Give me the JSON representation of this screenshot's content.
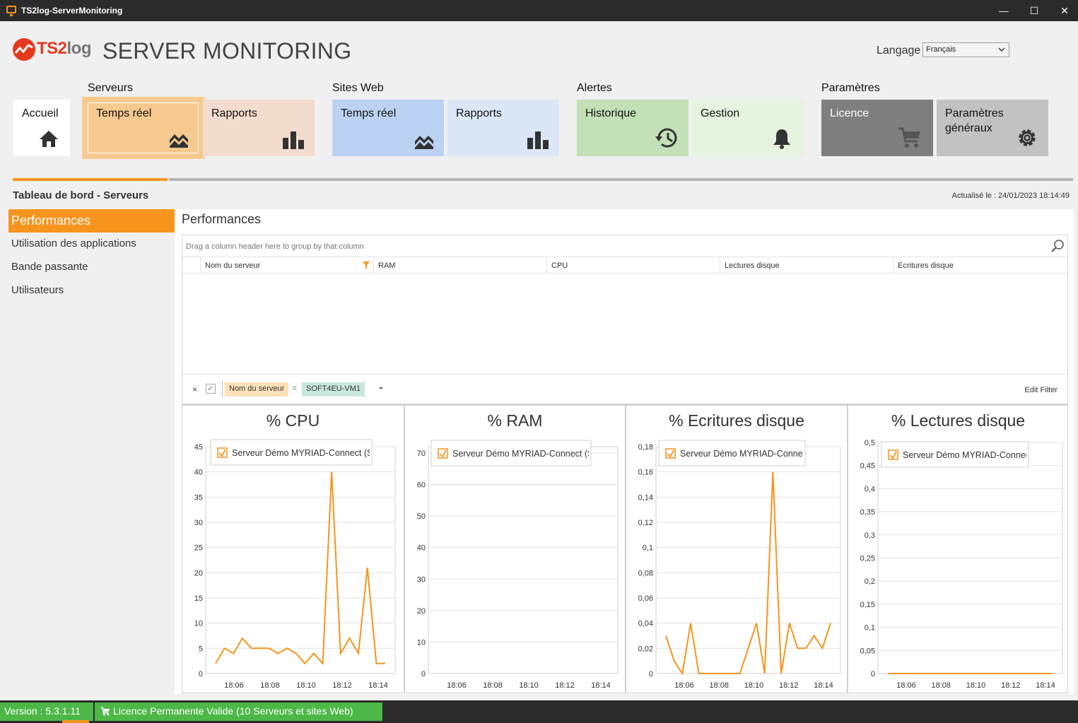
{
  "window": {
    "title": "TS2log-ServerMonitoring"
  },
  "header": {
    "brand_a": "TS2",
    "brand_b": "log",
    "app_title": "SERVER MONITORING",
    "language_label": "Langage",
    "language_value": "Français"
  },
  "groups": {
    "servers": "Serveurs",
    "sites": "Sites Web",
    "alerts": "Alertes",
    "settings": "Paramètres"
  },
  "tiles": {
    "home": "Accueil",
    "srv_realtime": "Temps réel",
    "srv_reports": "Rapports",
    "web_realtime": "Temps réel",
    "web_reports": "Rapports",
    "history": "Historique",
    "management": "Gestion",
    "license": "Licence",
    "general_settings": "Paramètres généraux"
  },
  "colors": {
    "accent": "#f7941d",
    "tile_srv_realtime": "#f5c98f",
    "tile_srv_reports": "#f3dccd",
    "tile_web_realtime": "#bcd2f2",
    "tile_web_reports": "#dbe7f7",
    "tile_history": "#c4e0b7",
    "tile_management": "#e6f3df",
    "tile_license": "#7f7f7f",
    "tile_general": "#c2c2c2",
    "status_green": "#4db848"
  },
  "breadcrumb": "Tableau de bord - Serveurs",
  "updated": "Actualisé le : 24/01/2023 18:14:49",
  "nav": {
    "items": [
      "Performances",
      "Utilisation des applications",
      "Bande passante",
      "Utilisateurs"
    ]
  },
  "panel": {
    "title": "Performances"
  },
  "grid": {
    "group_hint": "Drag a column header here to group by that column",
    "columns": [
      "Nom du serveur",
      "RAM",
      "CPU",
      "Lectures disque",
      "Ecritures disque"
    ],
    "filter": {
      "close": "×",
      "check": "✓",
      "field": "Nom du serveur",
      "op": "=",
      "value": "SOFT4EU-VM1",
      "edit": "Edit Filter"
    }
  },
  "chart_data": [
    {
      "type": "line",
      "title": "%  CPU",
      "legend": "Serveur Démo MYRIAD-Connect (SOFT",
      "x_ticks": [
        "18:06",
        "18:08",
        "18:10",
        "18:12",
        "18:14"
      ],
      "ylim": [
        0,
        45
      ],
      "y_ticks": [
        "0",
        "5",
        "10",
        "15",
        "20",
        "25",
        "30",
        "35",
        "40",
        "45"
      ],
      "series": [
        {
          "values": [
            2,
            5,
            4,
            7,
            5,
            5,
            5,
            4,
            5,
            4,
            2,
            4,
            2,
            40,
            4,
            7,
            4,
            21,
            2,
            2
          ]
        }
      ]
    },
    {
      "type": "line",
      "title": "%  RAM",
      "legend": "Serveur Démo MYRIAD-Connect (SOFT",
      "x_ticks": [
        "18:06",
        "18:08",
        "18:10",
        "18:12",
        "18:14"
      ],
      "ylim": [
        0,
        72
      ],
      "y_ticks": [
        "0",
        "10",
        "20",
        "30",
        "40",
        "50",
        "60",
        "70"
      ],
      "series": [
        {
          "values": []
        }
      ]
    },
    {
      "type": "line",
      "title": "%  Ecritures disque",
      "legend": "Serveur Démo MYRIAD-Connect (SOF",
      "x_ticks": [
        "18:06",
        "18:08",
        "18:10",
        "18:12",
        "18:14"
      ],
      "ylim": [
        0,
        0.18
      ],
      "y_ticks": [
        "0",
        "0,02",
        "0,04",
        "0,06",
        "0,08",
        "0,1",
        "0,12",
        "0,14",
        "0,16",
        "0,18"
      ],
      "series": [
        {
          "values": [
            0.03,
            0.01,
            0,
            0.04,
            0,
            0,
            0,
            0,
            0,
            0,
            0.02,
            0.04,
            0,
            0.16,
            0,
            0.04,
            0.02,
            0.02,
            0.03,
            0.02,
            0.04
          ]
        }
      ]
    },
    {
      "type": "line",
      "title": "%  Lectures disque",
      "legend": "Serveur Démo MYRIAD-Connect (SOF",
      "x_ticks": [
        "18:06",
        "18:08",
        "18:10",
        "18:12",
        "18:14"
      ],
      "ylim": [
        0,
        0.5
      ],
      "y_ticks": [
        "0",
        "0,05",
        "0,1",
        "0,15",
        "0,2",
        "0,25",
        "0,3",
        "0,35",
        "0,4",
        "0,45",
        "0,5"
      ],
      "series": [
        {
          "values": [
            0,
            0,
            0,
            0,
            0,
            0,
            0,
            0,
            0,
            0,
            0,
            0,
            0,
            0,
            0,
            0,
            0,
            0,
            0,
            0
          ]
        }
      ]
    }
  ],
  "status": {
    "version": "Version : 5.3.1.11",
    "license": "Licence Permanente Valide (10 Serveurs et sites Web)"
  }
}
